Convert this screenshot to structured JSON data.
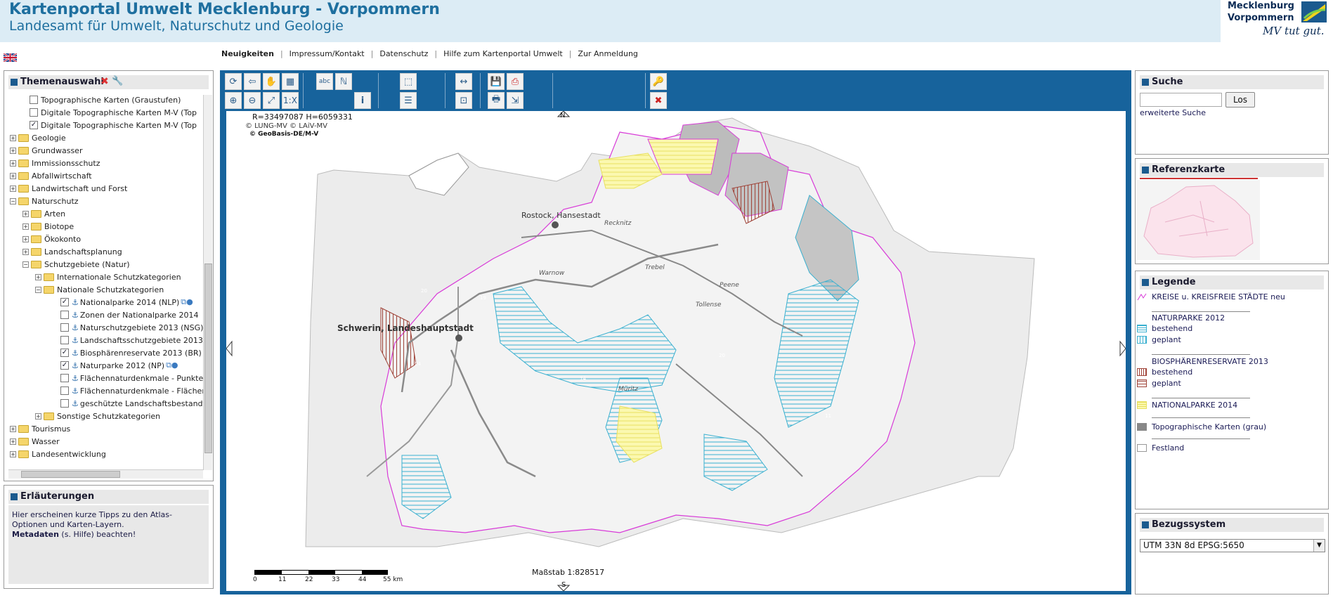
{
  "header": {
    "title": "Kartenportal Umwelt Mecklenburg - Vorpommern",
    "subtitle": "Landesamt für Umwelt, Naturschutz und Geologie",
    "logo_line1": "Mecklenburg",
    "logo_line2": "Vorpommern",
    "logo_slogan": "MV tut gut."
  },
  "language_icon": "uk-flag-icon",
  "nav": {
    "items": [
      "Neuigkeiten",
      "Impressum/Kontakt",
      "Datenschutz",
      "Hilfe zum Kartenportal Umwelt",
      "Zur Anmeldung"
    ]
  },
  "theme": {
    "title": "Themenauswahl",
    "items": [
      {
        "label": "Topographische Karten (Graustufen)",
        "checked": false
      },
      {
        "label": "Digitale Topographische Karten M-V (Top",
        "checked": false
      },
      {
        "label": "Digitale Topographische Karten M-V (Top",
        "checked": true
      },
      {
        "label": "Geologie"
      },
      {
        "label": "Grundwasser"
      },
      {
        "label": "Immissionsschutz"
      },
      {
        "label": "Abfallwirtschaft"
      },
      {
        "label": "Landwirtschaft und Forst"
      },
      {
        "label": "Naturschutz"
      },
      {
        "label": "Arten"
      },
      {
        "label": "Biotope"
      },
      {
        "label": "Ökokonto"
      },
      {
        "label": "Landschaftsplanung"
      },
      {
        "label": "Schutzgebiete (Natur)"
      },
      {
        "label": "Internationale Schutzkategorien"
      },
      {
        "label": "Nationale Schutzkategorien"
      },
      {
        "label": "Nationalparke 2014 (NLP)",
        "checked": true
      },
      {
        "label": "Zonen der Nationalparke 2014",
        "checked": false
      },
      {
        "label": "Naturschutzgebiete 2013 (NSG)",
        "checked": false
      },
      {
        "label": "Landschaftsschutzgebiete 2013",
        "checked": false
      },
      {
        "label": "Biosphärenreservate 2013 (BR)",
        "checked": true
      },
      {
        "label": "Naturparke 2012 (NP)",
        "checked": true
      },
      {
        "label": "Flächennaturdenkmale - Punkte",
        "checked": false
      },
      {
        "label": "Flächennaturdenkmale - Flächer",
        "checked": false
      },
      {
        "label": "geschützte Landschaftsbestandt",
        "checked": false
      },
      {
        "label": "Sonstige Schutzkategorien"
      },
      {
        "label": "Tourismus"
      },
      {
        "label": "Wasser"
      },
      {
        "label": "Landesentwicklung"
      }
    ]
  },
  "explanations": {
    "title": "Erläuterungen",
    "text": "Hier erscheinen kurze Tipps zu den Atlas-Optionen und Karten-Layern.",
    "meta_bold": "Metadaten",
    "meta_rest": " (s. Hilfe) beachten!"
  },
  "toolbar": {
    "scale_1x": "1:X",
    "text_tool": "abc",
    "info_tool": "i"
  },
  "map": {
    "coords": "R=33497087 H=6059331",
    "copyright1": "© LUNG-MV © LAiV-MV",
    "copyright2": "© GeoBasis-DE/M-V",
    "scale_label": "Maßstab 1:828517",
    "scale_ticks": [
      "0",
      "11",
      "22",
      "33",
      "44",
      "55 km"
    ],
    "places": [
      {
        "label": "Schwerin, Landeshauptstadt"
      },
      {
        "label": "Rostock, Hansestadt"
      },
      {
        "label": "Recknitz"
      },
      {
        "label": "Warnow"
      },
      {
        "label": "Trebel"
      },
      {
        "label": "Peene"
      },
      {
        "label": "Tollense"
      },
      {
        "label": "Müritz"
      }
    ],
    "highway_numbers": [
      "20",
      "19",
      "24",
      "14",
      "20",
      "11"
    ],
    "north": "N",
    "south": "S"
  },
  "search": {
    "title": "Suche",
    "input_value": "",
    "button": "Los",
    "extended": "erweiterte Suche"
  },
  "reference": {
    "title": "Referenzkarte"
  },
  "legend": {
    "title": "Legende",
    "kreise": "KREISE u. KREISFREIE STÄDTE neu",
    "np_title": "NATURPARKE 2012",
    "np1": "bestehend",
    "np2": "geplant",
    "br_title": "BIOSPHÄRENRESERVATE 2013",
    "br1": "bestehend",
    "br2": "geplant",
    "nlp": "NATIONALPARKE 2014",
    "topo": "Topographische Karten (grau)",
    "festland": "Festland",
    "colors": {
      "kreise": "#d83ad8",
      "np": "#3ab0d0",
      "br": "#a0453a",
      "nlp": "#f2f070"
    }
  },
  "bezug": {
    "title": "Bezugssystem",
    "selected": "UTM 33N 8d EPSG:5650"
  }
}
